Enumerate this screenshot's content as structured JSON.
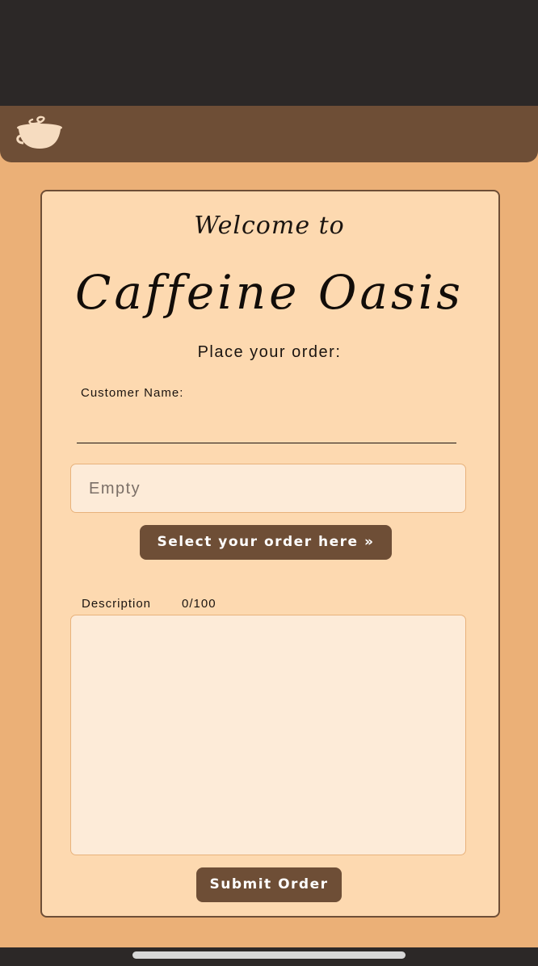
{
  "header": {
    "logo_icon": "coffee-cup-icon"
  },
  "form": {
    "welcome_text": "Welcome to",
    "brand_name": "Caffeine Oasis",
    "subtitle": "Place your order:",
    "customer_name_label": "Customer Name:",
    "customer_name_value": "",
    "order_field_value": "Empty",
    "select_button_label": "Select your order here »",
    "description_label": "Description",
    "description_counter": "0/100",
    "description_value": "",
    "submit_button_label": "Submit Order"
  },
  "colors": {
    "header_brown": "#6e4e36",
    "app_background": "#ebb077",
    "card_background": "#fdd9b0",
    "field_background": "#fdebd8",
    "button_text": "#ffffff"
  }
}
